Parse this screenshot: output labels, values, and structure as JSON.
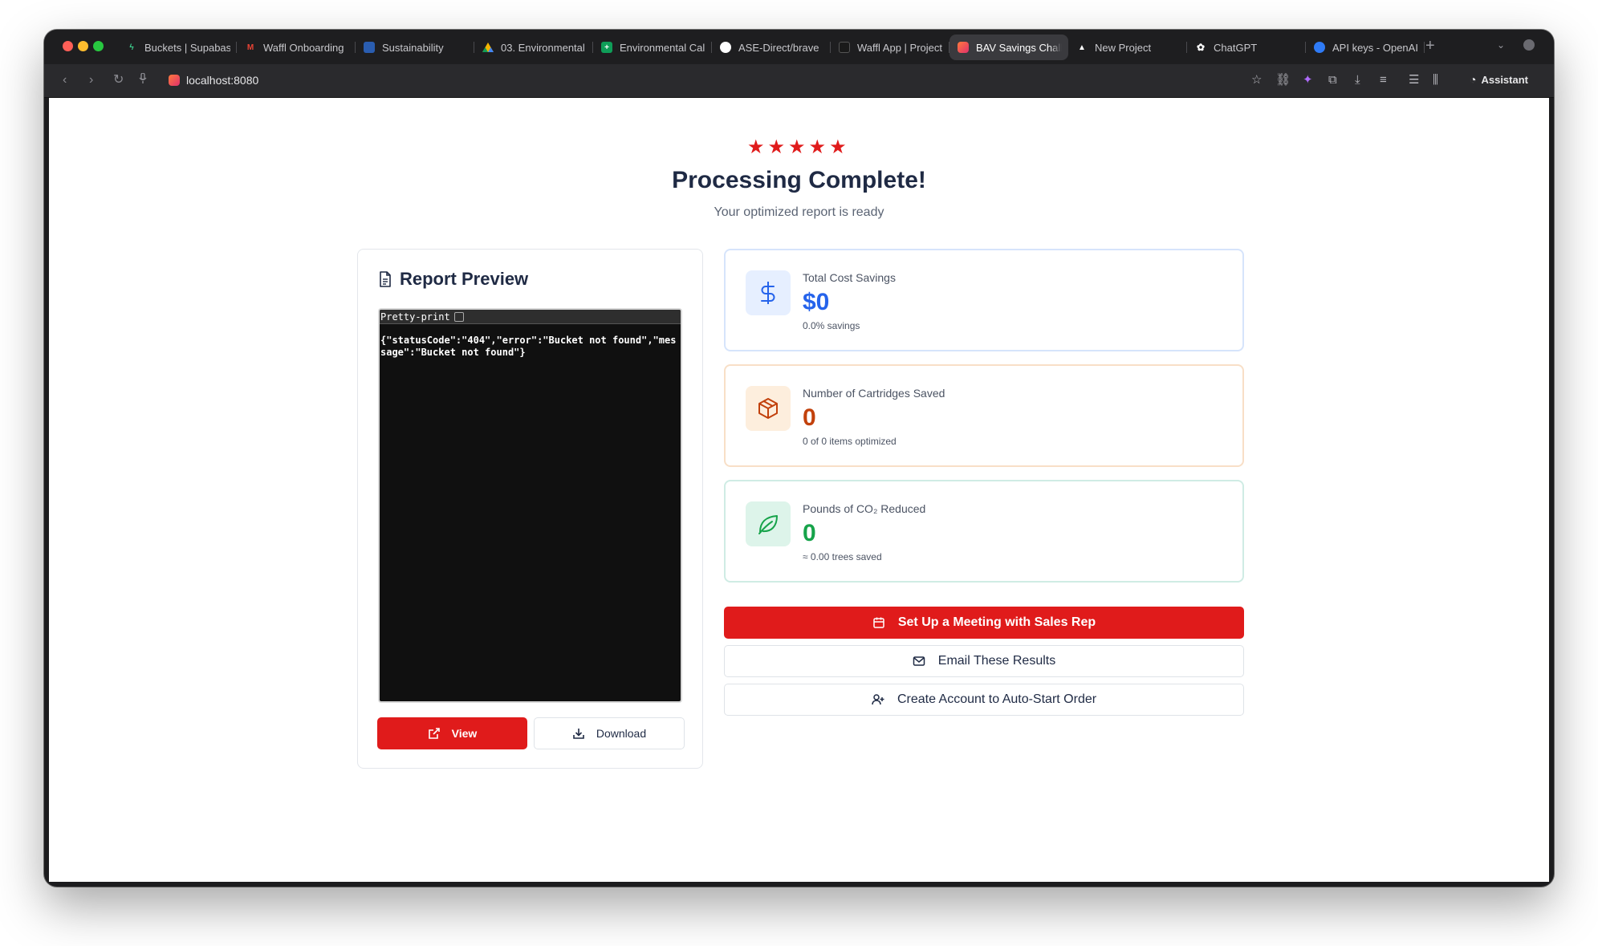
{
  "browser": {
    "tabs": [
      {
        "title": "Buckets | Supabase",
        "icon": "supabase-icon",
        "color": "#3ecf8e"
      },
      {
        "title": "Waffl Onboarding",
        "icon": "gmail-icon",
        "color": "#ea4335"
      },
      {
        "title": "Sustainability",
        "icon": "slides-icon",
        "color": "#2a5db0"
      },
      {
        "title": "03. Environmental",
        "icon": "google-drive-icon",
        "color": "#f4b400"
      },
      {
        "title": "Environmental Cal",
        "icon": "google-sheets-icon",
        "color": "#0f9d58"
      },
      {
        "title": "ASE-Direct/brave",
        "icon": "github-icon",
        "color": "#ffffff"
      },
      {
        "title": "Waffl App | Project",
        "icon": "app-icon",
        "color": "#1a1a1a"
      },
      {
        "title": "BAV Savings Chall",
        "icon": "lovable-icon",
        "color": "#ff4f6d",
        "active": true
      },
      {
        "title": "New Project",
        "icon": "vercel-icon",
        "color": "#ffffff"
      },
      {
        "title": "ChatGPT",
        "icon": "openai-icon",
        "color": "#ffffff"
      },
      {
        "title": "API keys - OpenAI",
        "icon": "openai-platform-icon",
        "color": "#2f7bf6"
      }
    ],
    "url": "localhost:8080",
    "assistant_label": "Assistant"
  },
  "page": {
    "star_count": 5,
    "heading": "Processing Complete!",
    "subheading": "Your optimized report is ready"
  },
  "preview": {
    "title": "Report Preview",
    "pretty_print_label": "Pretty-print",
    "json_text": "{\"statusCode\":\"404\",\"error\":\"Bucket not found\",\"message\":\"Bucket not found\"}",
    "view_label": "View",
    "download_label": "Download"
  },
  "stats": {
    "cost": {
      "label": "Total Cost Savings",
      "value": "$0",
      "sub": "0.0% savings",
      "icon": "dollar-icon",
      "color": "#2563eb"
    },
    "cartridges": {
      "label": "Number of Cartridges Saved",
      "value": "0",
      "sub": "0 of 0 items optimized",
      "icon": "package-icon",
      "color": "#c2410c"
    },
    "co2": {
      "label": "Pounds of CO₂ Reduced",
      "value": "0",
      "sub": "≈ 0.00 trees saved",
      "icon": "leaf-icon",
      "color": "#16a34a"
    }
  },
  "actions": {
    "meeting_label": "Set Up a Meeting with Sales Rep",
    "email_label": "Email These Results",
    "account_label": "Create Account to Auto-Start Order"
  },
  "colors": {
    "accent_red": "#e01b1b",
    "heading_navy": "#1f2a44"
  }
}
